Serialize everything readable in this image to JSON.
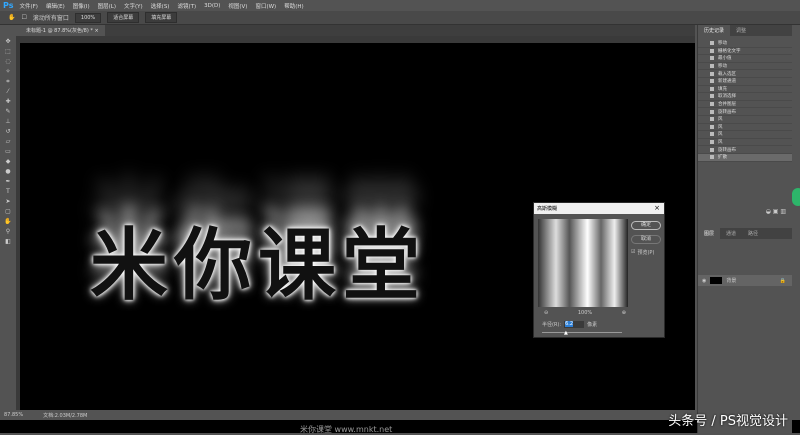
{
  "app": {
    "logo": "Ps"
  },
  "menu": [
    "文件(F)",
    "编辑(E)",
    "图像(I)",
    "图层(L)",
    "文字(Y)",
    "选择(S)",
    "滤镜(T)",
    "3D(D)",
    "视图(V)",
    "窗口(W)",
    "帮助(H)"
  ],
  "options": {
    "scroll_all": "滚动所有窗口",
    "zoom": "100%",
    "fit_screen": "适合屏幕",
    "fill_screen": "填充屏幕"
  },
  "document": {
    "tab": "未标题-1 @ 87.8%(灰色/8) * ×",
    "art_text": "米你课堂"
  },
  "status": {
    "zoom": "87.85%",
    "doc": "文档:2.03M/2.78M"
  },
  "history": {
    "tabs": [
      "历史记录",
      "调整"
    ],
    "items": [
      "移动",
      "栅格化文字",
      "最小值",
      "移动",
      "载入选区",
      "新建通道",
      "填充",
      "取消选择",
      "合并图层",
      "旋转画布",
      "风",
      "风",
      "风",
      "风",
      "旋转画布",
      "扩散"
    ]
  },
  "layers": {
    "tabs": [
      "图层",
      "通道",
      "路径"
    ],
    "layer_name": "背景"
  },
  "dialog": {
    "title": "高斯模糊",
    "ok": "确定",
    "cancel": "取消",
    "preview": "预览(P)",
    "zoom": "100%",
    "radius_label": "半径(R):",
    "radius": "6.2",
    "unit": "像素"
  },
  "watermark": {
    "main": "头条号 / PS视觉设计",
    "sub": "米你课堂 www.mnkt.net"
  }
}
